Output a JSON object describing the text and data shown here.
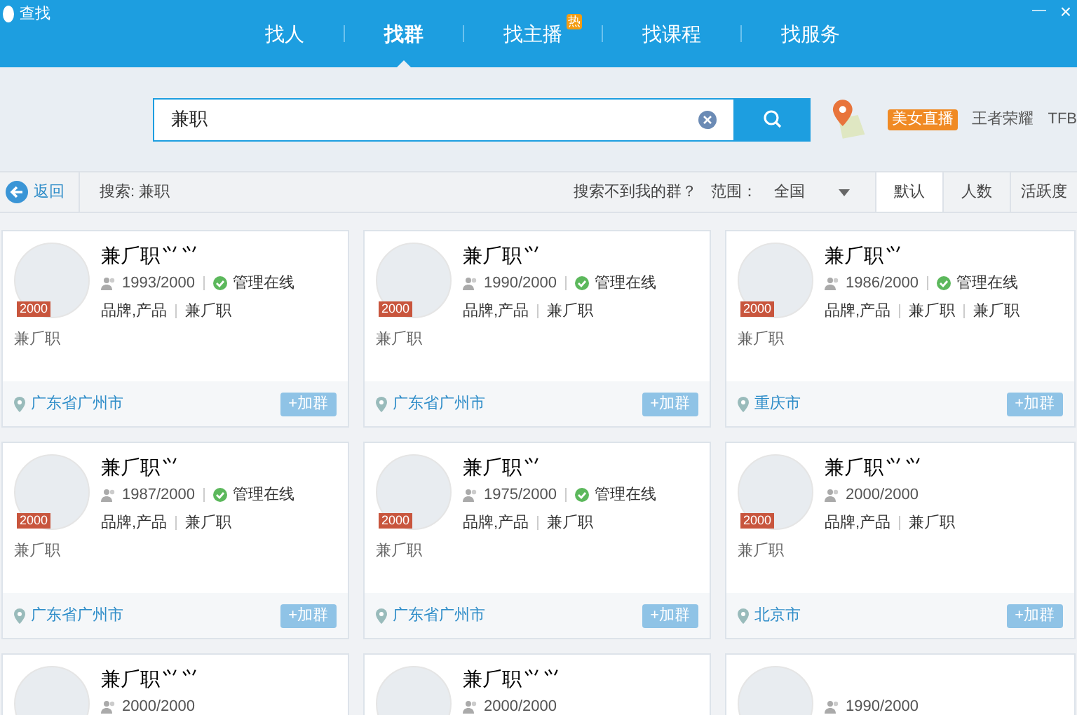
{
  "window": {
    "title": "查找",
    "close": "×",
    "minimize": "—"
  },
  "nav": [
    {
      "label": "找人",
      "selected": false
    },
    {
      "label": "找群",
      "selected": true
    },
    {
      "label": "找主播",
      "selected": false,
      "badge": "热"
    },
    {
      "label": "找课程",
      "selected": false
    },
    {
      "label": "找服务",
      "selected": false
    }
  ],
  "search": {
    "value": "兼职"
  },
  "hot_tags": [
    {
      "label": "美女直播",
      "kind": "highlight"
    },
    {
      "label": "王者荣耀",
      "kind": "plain"
    },
    {
      "label": "TFB",
      "kind": "plain"
    }
  ],
  "toolbar": {
    "back": "返回",
    "query": "搜索: 兼职",
    "not_found": "搜索不到我的群？",
    "scope_label": "范围：",
    "scope": "全国",
    "sorts": [
      {
        "label": "默认",
        "selected": true
      },
      {
        "label": "人数",
        "selected": false
      },
      {
        "label": "活跃度",
        "selected": false
      }
    ]
  },
  "cards": [
    {
      "badge": "2000",
      "name": "兼⺁职⺍⺍",
      "count": "1993/2000",
      "admin": "管理在线",
      "tags": [
        "品牌,产品",
        "兼⺁职"
      ],
      "desc": "兼⺁职",
      "location": "广东省广州市",
      "join": "+加群"
    },
    {
      "badge": "2000",
      "name": "兼⺁职⺍",
      "count": "1990/2000",
      "admin": "管理在线",
      "tags": [
        "品牌,产品",
        "兼⺁职"
      ],
      "desc": "兼⺁职",
      "location": "广东省广州市",
      "join": "+加群"
    },
    {
      "badge": "2000",
      "name": "兼⺁职⺍",
      "count": "1986/2000",
      "admin": "管理在线",
      "tags": [
        "品牌,产品",
        "兼⺁职",
        "兼⺁职"
      ],
      "desc": "兼⺁职",
      "location": "重庆市",
      "join": "+加群"
    },
    {
      "badge": "2000",
      "name": "兼⺁职⺍",
      "count": "1987/2000",
      "admin": "管理在线",
      "tags": [
        "品牌,产品",
        "兼⺁职"
      ],
      "desc": "兼⺁职",
      "location": "广东省广州市",
      "join": "+加群"
    },
    {
      "badge": "2000",
      "name": "兼⺁职⺍",
      "count": "1975/2000",
      "admin": "管理在线",
      "tags": [
        "品牌,产品",
        "兼⺁职"
      ],
      "desc": "兼⺁职",
      "location": "广东省广州市",
      "join": "+加群"
    },
    {
      "badge": "2000",
      "name": "兼⺁职⺍⺍",
      "count": "2000/2000",
      "tags": [
        "品牌,产品",
        "兼⺁职"
      ],
      "desc": "兼⺁职",
      "location": "北京市",
      "join": "+加群"
    },
    {
      "name": "兼⺁职⺍⺍",
      "count": "2000/2000"
    },
    {
      "name": "兼⺁职⺍⺍",
      "count": "2000/2000"
    },
    {
      "count": "1990/2000"
    }
  ]
}
